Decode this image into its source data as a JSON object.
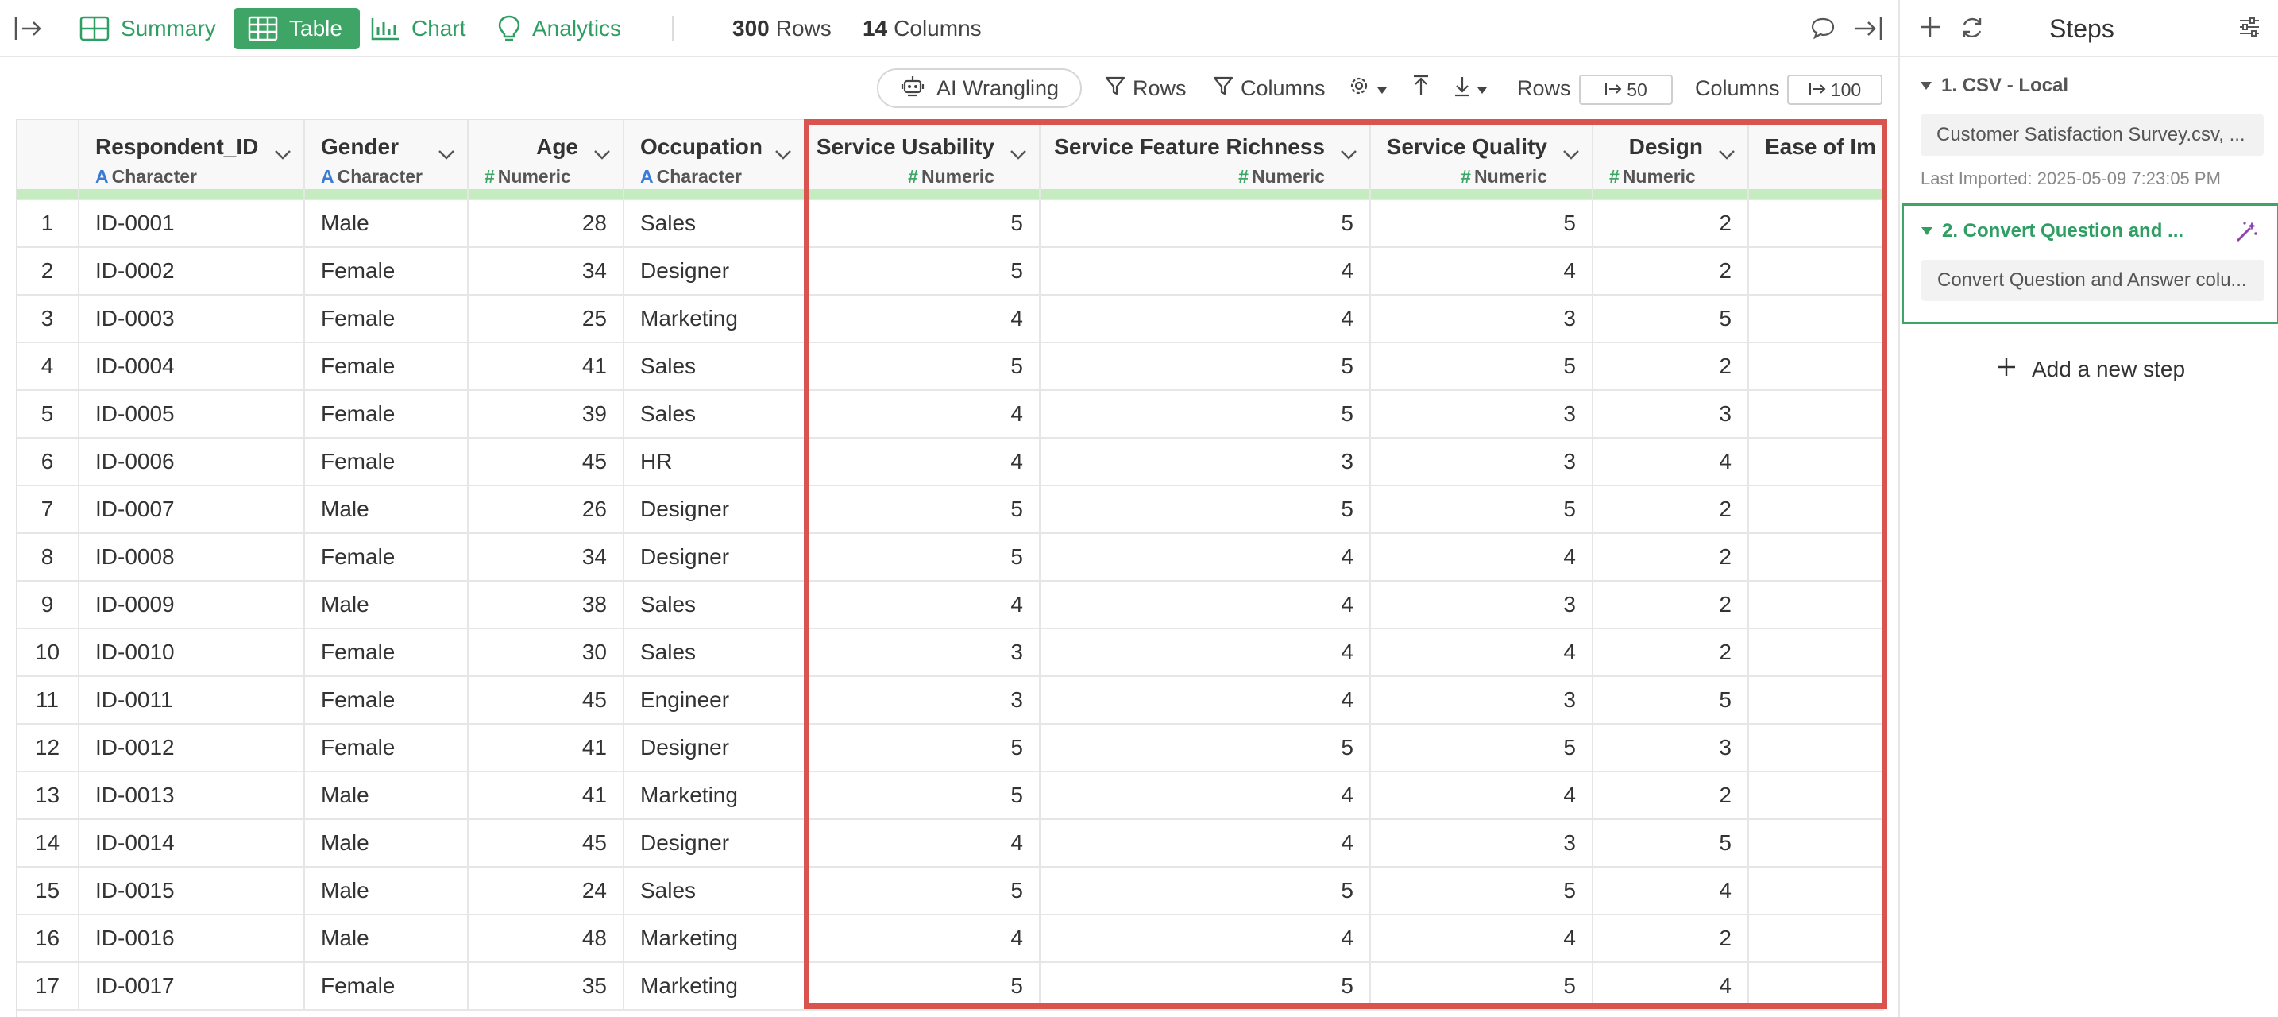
{
  "toolbar": {
    "tabs": [
      {
        "label": "Summary"
      },
      {
        "label": "Table"
      },
      {
        "label": "Chart"
      },
      {
        "label": "Analytics"
      }
    ],
    "rows_count": "300",
    "rows_word": "Rows",
    "columns_count": "14",
    "columns_word": "Columns"
  },
  "subtoolbar": {
    "ai_wrangling": "AI Wrangling",
    "rows_filter": "Rows",
    "columns_filter": "Columns",
    "rows_label": "Rows",
    "rows_limit": "50",
    "columns_label": "Columns",
    "columns_limit": "100"
  },
  "table": {
    "columns": [
      {
        "name": "Respondent_ID",
        "type": "Character"
      },
      {
        "name": "Gender",
        "type": "Character"
      },
      {
        "name": "Age",
        "type": "Numeric"
      },
      {
        "name": "Occupation",
        "type": "Character"
      },
      {
        "name": "Service Usability",
        "type": "Numeric"
      },
      {
        "name": "Service Feature Richness",
        "type": "Numeric"
      },
      {
        "name": "Service Quality",
        "type": "Numeric"
      },
      {
        "name": "Design",
        "type": "Numeric"
      },
      {
        "name": "Ease of Im",
        "type": ""
      }
    ],
    "rows": [
      [
        "1",
        "ID-0001",
        "Male",
        "28",
        "Sales",
        "5",
        "5",
        "5",
        "2"
      ],
      [
        "2",
        "ID-0002",
        "Female",
        "34",
        "Designer",
        "5",
        "4",
        "4",
        "2"
      ],
      [
        "3",
        "ID-0003",
        "Female",
        "25",
        "Marketing",
        "4",
        "4",
        "3",
        "5"
      ],
      [
        "4",
        "ID-0004",
        "Female",
        "41",
        "Sales",
        "5",
        "5",
        "5",
        "2"
      ],
      [
        "5",
        "ID-0005",
        "Female",
        "39",
        "Sales",
        "4",
        "5",
        "3",
        "3"
      ],
      [
        "6",
        "ID-0006",
        "Female",
        "45",
        "HR",
        "4",
        "3",
        "3",
        "4"
      ],
      [
        "7",
        "ID-0007",
        "Male",
        "26",
        "Designer",
        "5",
        "5",
        "5",
        "2"
      ],
      [
        "8",
        "ID-0008",
        "Female",
        "34",
        "Designer",
        "5",
        "4",
        "4",
        "2"
      ],
      [
        "9",
        "ID-0009",
        "Male",
        "38",
        "Sales",
        "4",
        "4",
        "3",
        "2"
      ],
      [
        "10",
        "ID-0010",
        "Female",
        "30",
        "Sales",
        "3",
        "4",
        "4",
        "2"
      ],
      [
        "11",
        "ID-0011",
        "Female",
        "45",
        "Engineer",
        "3",
        "4",
        "3",
        "5"
      ],
      [
        "12",
        "ID-0012",
        "Female",
        "41",
        "Designer",
        "5",
        "5",
        "5",
        "3"
      ],
      [
        "13",
        "ID-0013",
        "Male",
        "41",
        "Marketing",
        "5",
        "4",
        "4",
        "2"
      ],
      [
        "14",
        "ID-0014",
        "Male",
        "45",
        "Designer",
        "4",
        "4",
        "3",
        "5"
      ],
      [
        "15",
        "ID-0015",
        "Male",
        "24",
        "Sales",
        "5",
        "5",
        "5",
        "4"
      ],
      [
        "16",
        "ID-0016",
        "Male",
        "48",
        "Marketing",
        "4",
        "4",
        "4",
        "2"
      ],
      [
        "17",
        "ID-0017",
        "Female",
        "35",
        "Marketing",
        "5",
        "5",
        "5",
        "4"
      ]
    ]
  },
  "highlight_color": "#d9534f",
  "accent_color": "#3fa567",
  "steps_panel": {
    "title": "Steps",
    "steps": [
      {
        "title": "1. CSV - Local",
        "detail": "Customer Satisfaction Survey.csv, ...",
        "meta": "Last Imported: 2025-05-09 7:23:05 PM"
      },
      {
        "title": "2. Convert Question and ...",
        "detail": "Convert Question and Answer colu..."
      }
    ],
    "add_step": "Add a new step"
  }
}
